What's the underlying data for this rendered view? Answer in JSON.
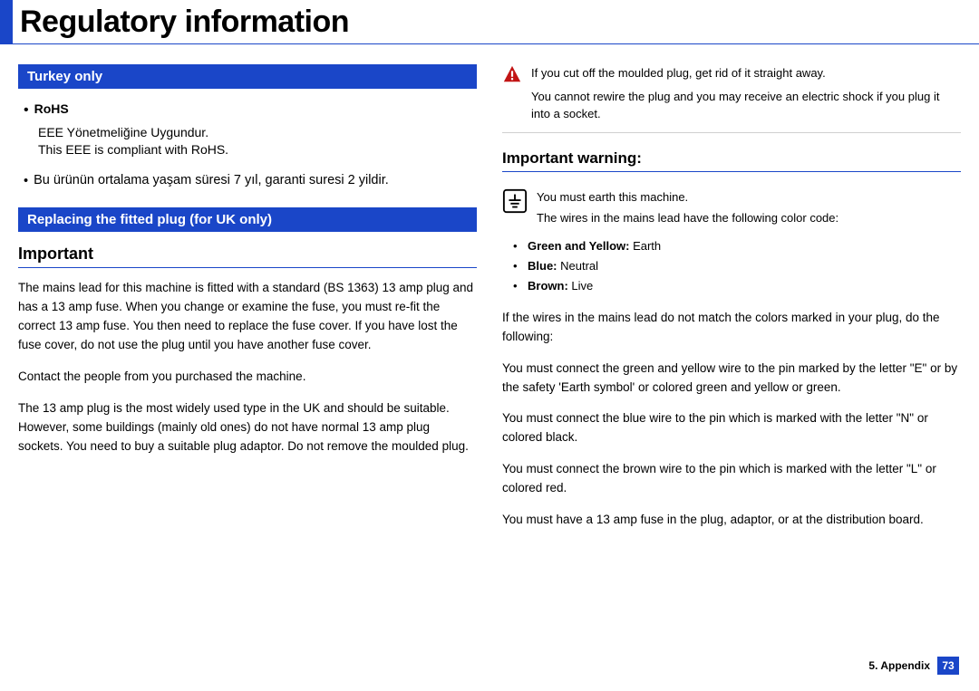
{
  "title": "Regulatory information",
  "left": {
    "turkey_header": "Turkey only",
    "rohs_label": "RoHS",
    "rohs_line1": "EEE Yönetmeliğine Uygundur.",
    "rohs_line2": "This EEE is compliant with RoHS.",
    "turkish_life": "Bu ürünün ortalama yaşam süresi 7 yıl, garanti suresi 2 yildir.",
    "uk_header": "Replacing the fitted plug (for UK only)",
    "important": "Important",
    "p1": "The mains lead for this machine is fitted with a standard (BS 1363) 13 amp plug and has a 13 amp fuse. When you change or examine the fuse, you must re-fit the correct 13 amp fuse. You then need to replace the fuse cover. If you have lost the fuse cover, do not use the plug until you have another fuse cover.",
    "p2": "Contact the people from you purchased the machine.",
    "p3": "The 13 amp plug is the most widely used type in the UK and should be suitable. However, some buildings (mainly old ones) do not have normal 13 amp plug sockets. You need to buy a suitable plug adaptor. Do not remove the moulded plug."
  },
  "right": {
    "warn1": "If you cut off the moulded plug, get rid of it straight away.",
    "warn2": "You cannot rewire the plug and you may receive an electric shock if you plug it into a socket.",
    "heading": "Important warning:",
    "earth1": "You must earth this machine.",
    "earth2": "The wires in the mains lead have the following color code:",
    "wires": [
      {
        "bold": "Green and Yellow:",
        "rest": " Earth"
      },
      {
        "bold": "Blue:",
        "rest": " Neutral"
      },
      {
        "bold": "Brown:",
        "rest": " Live"
      }
    ],
    "p4": "If the wires in the mains lead do not match the colors marked in your plug, do the following:",
    "p5": "You must connect the green and yellow wire to the pin marked by the letter \"E\" or by the safety 'Earth symbol' or colored green and yellow or green.",
    "p6": "You must connect the blue wire to the pin which is marked with the letter \"N\" or colored black.",
    "p7": "You must connect the brown wire to the pin which is marked with the letter \"L\" or colored red.",
    "p8": "You must have a 13 amp fuse in the plug, adaptor, or at the distribution board."
  },
  "footer": {
    "section": "5. Appendix",
    "page": "73"
  }
}
